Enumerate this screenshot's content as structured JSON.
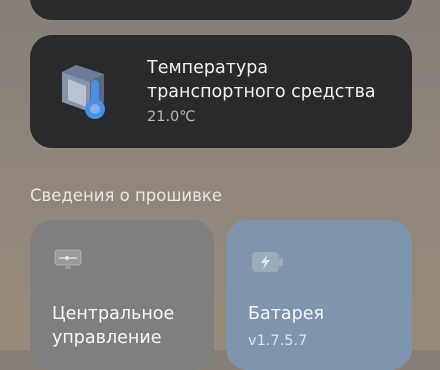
{
  "vehicle_temperature": {
    "icon": "thermometer-icon",
    "title": "Температура транспортного средства",
    "value": "21.0℃"
  },
  "firmware": {
    "section_title": "Сведения о прошивке",
    "central_control": {
      "icon": "control-unit-icon",
      "label": "Центральное управление"
    },
    "battery": {
      "icon": "battery-icon",
      "label": "Батарея",
      "version": "v1.7.5.7"
    }
  },
  "colors": {
    "card_dark": "#2a2a2d",
    "card_gray": "#7f7f7f",
    "card_blue": "#7f95ad",
    "accent_blue": "#4b8fe0"
  }
}
